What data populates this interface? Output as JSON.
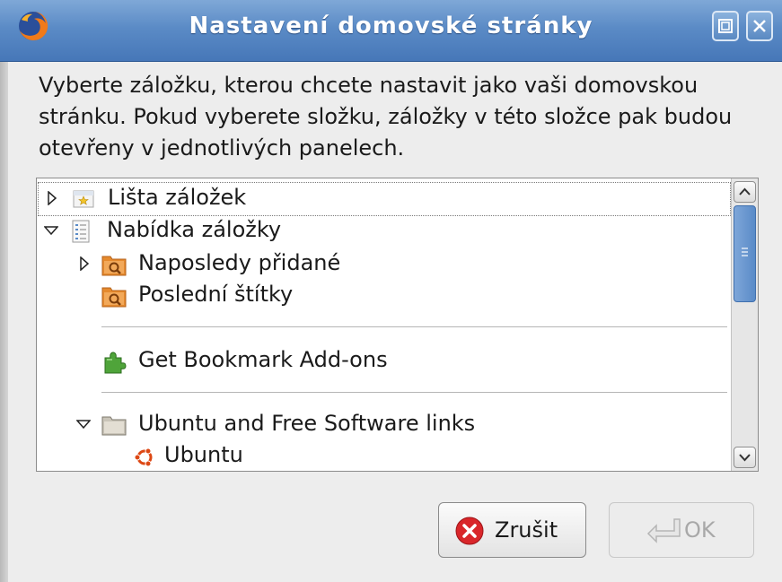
{
  "window": {
    "title": "Nastavení domovské stránky",
    "app_icon": "firefox-icon"
  },
  "description": "Vyberte záložku, kterou chcete nastavit jako vaši domovskou stránku. Pokud vyberete složku, záložky v této složce pak budou otevřeny v jednotlivých panelech.",
  "tree": {
    "items": [
      {
        "label": "Lišta záložek",
        "expander": "collapsed",
        "icon": "bookmarks-toolbar-icon"
      },
      {
        "label": "Nabídka záložky",
        "expander": "expanded",
        "icon": "bookmarks-menu-icon"
      },
      {
        "label": "Naposledy přidané",
        "expander": "collapsed",
        "icon": "smart-folder-icon"
      },
      {
        "label": "Poslední štítky",
        "expander": "none",
        "icon": "smart-folder-icon"
      },
      {
        "label": "Get Bookmark Add-ons",
        "expander": "none",
        "icon": "puzzle-addon-icon"
      },
      {
        "label": "Ubuntu and Free Software links",
        "expander": "expanded",
        "icon": "folder-icon"
      },
      {
        "label": "Ubuntu",
        "expander": "none",
        "icon": "ubuntu-logo-icon"
      }
    ]
  },
  "buttons": {
    "cancel": "Zrušit",
    "ok": "OK"
  },
  "colors": {
    "titlebar": "#5b8bc6",
    "cancel_icon": "#d9262a",
    "folder_orange": "#e58a2e"
  }
}
